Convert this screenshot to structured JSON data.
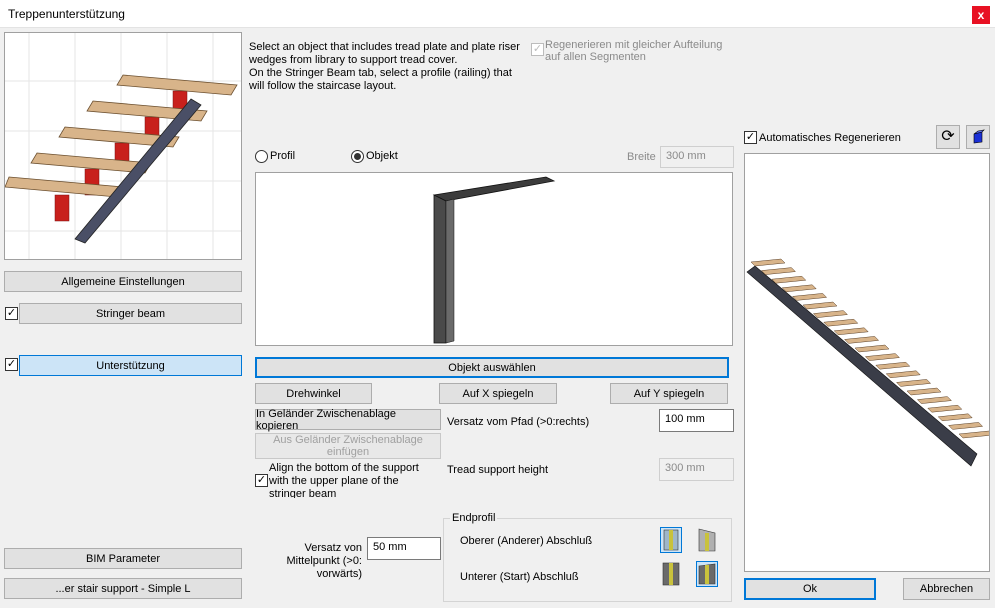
{
  "window": {
    "title": "Treppenunterstützung",
    "close_label": "x"
  },
  "info_text": [
    "Select an object that includes tread plate and plate riser",
    "wedges from library to support tread cover.",
    "On the Stringer Beam tab, select a profile (railing) that",
    "will follow the staircase layout."
  ],
  "regen_same": {
    "label": [
      "Regenerieren mit gleicher Aufteilung",
      "auf allen Segmenten"
    ],
    "checked": true,
    "disabled": true
  },
  "sidebar": {
    "general_settings": "Allgemeine Einstellungen",
    "stringer_beam": "Stringer beam",
    "unterstuetzung": "Unterstützung",
    "bim_parameter": "BIM Parameter",
    "preset": "...er stair support - Simple L"
  },
  "mode": {
    "profil": "Profil",
    "objekt": "Objekt",
    "selected": "Objekt"
  },
  "breite": {
    "label": "Breite",
    "value": "300 mm"
  },
  "buttons": {
    "select_object": "Objekt auswählen",
    "rotation": "Drehwinkel",
    "mirror_x": "Auf X spiegeln",
    "mirror_y": "Auf Y spiegeln",
    "copy_clipboard": "In Geländer Zwischenablage kopieren",
    "paste_clipboard": [
      "Aus Geländer Zwischenablage",
      "einfügen"
    ]
  },
  "offset_path": {
    "label": "Versatz vom Pfad (>0:rechts)",
    "value": "100 mm"
  },
  "tread_height": {
    "label": "Tread support height",
    "value": "300 mm"
  },
  "align_bottom": {
    "label": [
      "Align the bottom of the support",
      "with the upper plane of the",
      "stringer beam"
    ],
    "checked": true
  },
  "offset_mid": {
    "label": [
      "Versatz von",
      "Mittelpunkt (>0:",
      "vorwärts)"
    ],
    "value": "50 mm"
  },
  "endprofil": {
    "title": "Endprofil",
    "upper": "Oberer (Anderer) Abschluß",
    "lower": "Unterer (Start) Abschluß"
  },
  "auto_regen": {
    "label": "Automatisches Regenerieren",
    "checked": true
  },
  "footer": {
    "ok": "Ok",
    "cancel": "Abbrechen"
  },
  "colors": {
    "accent": "#0078d7",
    "wood": "#d8b48a",
    "red": "#c8201c",
    "steel": "#4a4f66"
  }
}
